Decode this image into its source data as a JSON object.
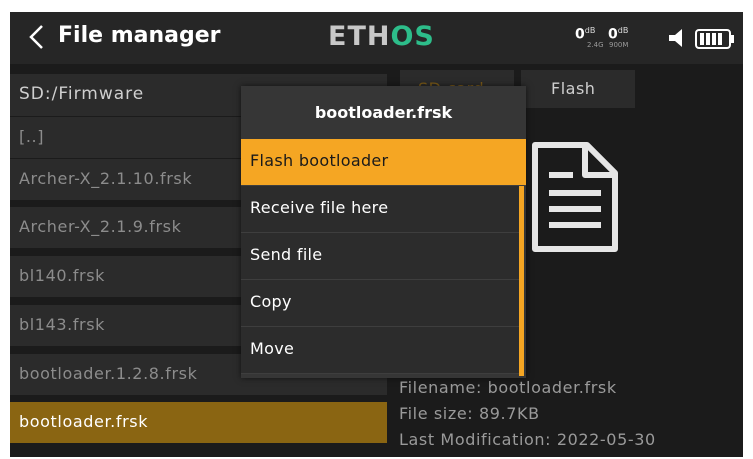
{
  "header": {
    "title": "File manager",
    "logo_left": "ETH",
    "logo_right": "OS",
    "rssi_left": {
      "value": "0",
      "unit": "dB",
      "band": "2.4G"
    },
    "rssi_right": {
      "value": "0",
      "unit": "dB",
      "band": "900M"
    },
    "icons": [
      "back-chevron-icon",
      "speaker-icon",
      "battery-icon"
    ]
  },
  "browser": {
    "path": "SD:/Firmware",
    "files": [
      {
        "name": "[..]",
        "selected": false
      },
      {
        "name": "Archer-X_2.1.10.frsk",
        "selected": false
      },
      {
        "name": "Archer-X_2.1.9.frsk",
        "selected": false
      },
      {
        "name": "bl140.frsk",
        "selected": false
      },
      {
        "name": "bl143.frsk",
        "selected": false
      },
      {
        "name": "bootloader.1.2.8.frsk",
        "selected": false
      },
      {
        "name": "bootloader.frsk",
        "selected": true
      }
    ]
  },
  "tabs": [
    {
      "label": "SD card",
      "active": true
    },
    {
      "label": "Flash",
      "active": false
    }
  ],
  "details": {
    "filename": "Filename: bootloader.frsk",
    "size": "File size: 89.7KB",
    "modified": "Last Modification: 2022-05-30"
  },
  "dialog": {
    "title": "bootloader.frsk",
    "items": [
      {
        "label": "Flash bootloader",
        "active": true
      },
      {
        "label": "Receive file here",
        "active": false
      },
      {
        "label": "Send file",
        "active": false
      },
      {
        "label": "Copy",
        "active": false
      },
      {
        "label": "Move",
        "active": false
      }
    ]
  },
  "colors": {
    "accent": "#f5a623",
    "selected_row": "#8a6512",
    "logo_os": "#2dbd8a",
    "background": "#1b1b1b"
  }
}
